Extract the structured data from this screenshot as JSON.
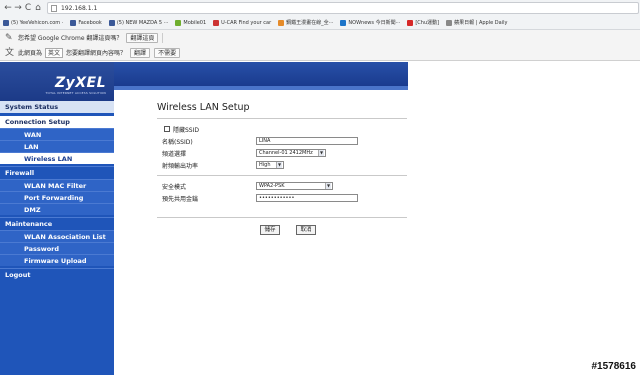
{
  "browser": {
    "back": "←",
    "forward": "→",
    "reload": "C",
    "home": "⌂",
    "url": "192.168.1.1",
    "bookmarks": [
      {
        "label": "(5) YeeVehicon.com ·",
        "color": "#3b5998"
      },
      {
        "label": "Facebook",
        "color": "#3b5998"
      },
      {
        "label": "(5) NEW MAZDA 5 ···",
        "color": "#3b5998"
      },
      {
        "label": "Mobile01",
        "color": "#6fae2f"
      },
      {
        "label": "U-CAR Find your car",
        "color": "#cc3333"
      },
      {
        "label": "鋼鐵王漫畫在線_全···",
        "color": "#e58b2a"
      },
      {
        "label": "NOWnews 今日新聞···",
        "color": "#1c74c9"
      },
      {
        "label": "[Chu運動]",
        "color": "#d62828"
      },
      {
        "label": "蘋果日報 | Apple Daily",
        "color": "#888888"
      }
    ],
    "translate_prompt": "您希望 Google Chrome 翻譯這頁嗎？",
    "translate_button": "翻譯這頁",
    "language_label": "此網頁為",
    "language_value": "英文",
    "translate_question": "您要翻譯網頁內容嗎？",
    "translate_yes": "翻譯",
    "translate_no": "不需要"
  },
  "logo": {
    "brand": "ZyXEL",
    "tagline": "TOTAL INTERNET ACCESS SOLUTION"
  },
  "menu": {
    "system_status": "System Status",
    "connection_setup": "Connection Setup",
    "wan": "WAN",
    "lan": "LAN",
    "wireless_lan": "Wireless LAN",
    "firewall": "Firewall",
    "wlan_mac_filter": "WLAN MAC Filter",
    "port_forwarding": "Port Forwarding",
    "dmz": "DMZ",
    "maintenance": "Maintenance",
    "wlan_association_list": "WLAN Association List",
    "password": "Password",
    "firmware_upload": "Firmware Upload",
    "logout": "Logout"
  },
  "form": {
    "title": "Wireless LAN Setup",
    "hide_ssid_label": "隱藏SSID",
    "ssid_label": "名稱(SSID)",
    "ssid_value": "LINA",
    "channel_label": "頻道選擇",
    "channel_value": "Channel-01 2412MHz",
    "power_label": "射頻輸出功率",
    "power_value": "High",
    "security_label": "安全模式",
    "security_value": "WPA2-PSK",
    "psk_label": "預先共用金鑰",
    "psk_value": "••••••••••••",
    "apply_button": "儲存",
    "cancel_button": "取消"
  },
  "watermark": "#1578616"
}
